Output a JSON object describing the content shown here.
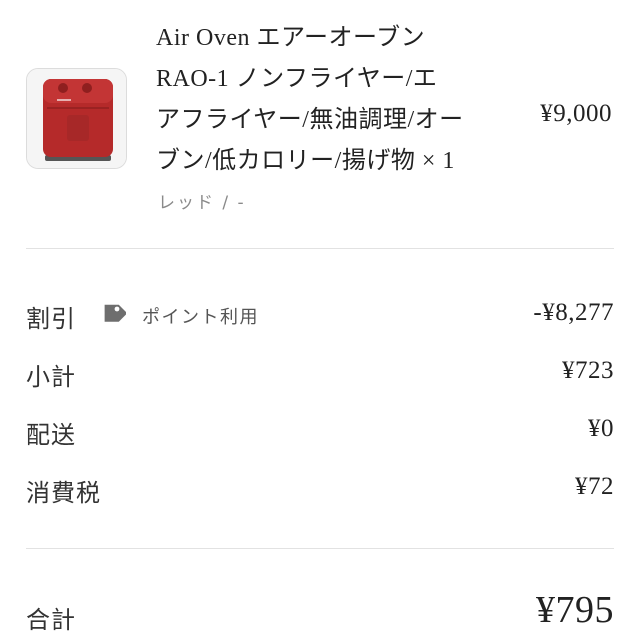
{
  "item": {
    "title_lines": [
      "Air Oven エアーオーブン",
      "RAO-1 ノンフライヤー/エ",
      "アフライヤー/無油調理/オー",
      "ブン/低カロリー/揚げ物 × 1"
    ],
    "price": "¥9,000",
    "variant": "レッド / -",
    "image_icon": "air-fryer-product-image",
    "product_color": "#b52a2a"
  },
  "summary": {
    "discount": {
      "label": "割引",
      "tag_icon": "tag-icon",
      "tag_label": "ポイント利用",
      "value": "-¥8,277"
    },
    "subtotal": {
      "label": "小計",
      "value": "¥723"
    },
    "shipping": {
      "label": "配送",
      "value": "¥0"
    },
    "tax": {
      "label": "消費税",
      "value": "¥72"
    },
    "total": {
      "label": "合計",
      "value": "¥795"
    }
  }
}
